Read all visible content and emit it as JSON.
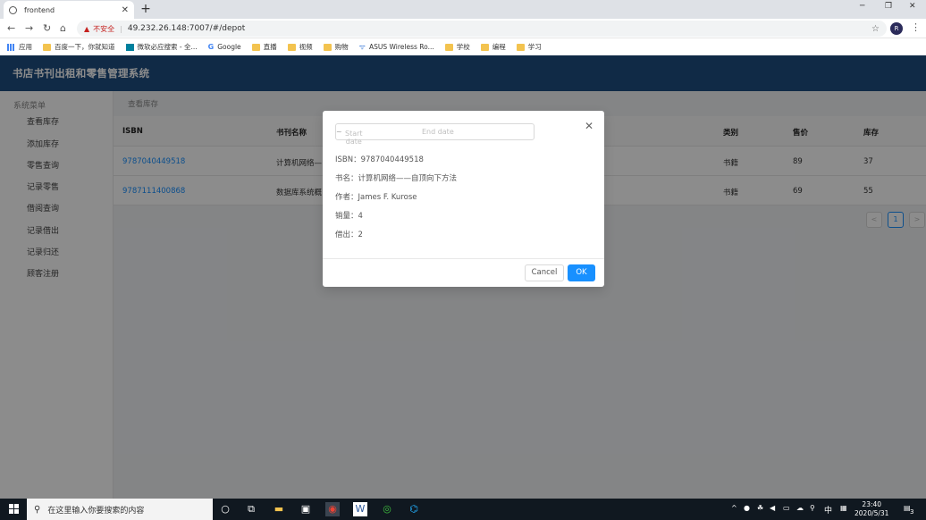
{
  "browser": {
    "tab_title": "frontend",
    "new_tab": "+",
    "insecure_label": "不安全",
    "url": "49.232.26.148:7007/#/depot",
    "bookmarks": [
      {
        "label": "应用",
        "icon": "apps-grid-icon"
      },
      {
        "label": "百度一下，你就知道",
        "icon": "folder-icon"
      },
      {
        "label": "微软必应搜索 - 全...",
        "icon": "bing-icon"
      },
      {
        "label": "Google",
        "icon": "google-icon"
      },
      {
        "label": "直播",
        "icon": "folder-icon"
      },
      {
        "label": "视频",
        "icon": "folder-icon"
      },
      {
        "label": "购物",
        "icon": "folder-icon"
      },
      {
        "label": "ASUS Wireless Ro...",
        "icon": "asus-icon"
      },
      {
        "label": "学校",
        "icon": "folder-icon"
      },
      {
        "label": "编程",
        "icon": "folder-icon"
      },
      {
        "label": "学习",
        "icon": "folder-icon"
      }
    ]
  },
  "app": {
    "title": "书店书刊出租和零售管理系统",
    "sidebar": {
      "group": "系统菜单",
      "items": [
        "查看库存",
        "添加库存",
        "零售查询",
        "记录零售",
        "借阅查询",
        "记录借出",
        "记录归还",
        "顾客注册"
      ]
    },
    "breadcrumb": "查看库存",
    "table": {
      "headers": {
        "isbn": "ISBN",
        "name": "书刊名称",
        "category": "类别",
        "price": "售价",
        "stock": "库存"
      },
      "rows": [
        {
          "isbn": "9787040449518",
          "name": "计算机网络—",
          "category": "书籍",
          "price": "89",
          "stock": "37"
        },
        {
          "isbn": "9787111400868",
          "name": "数据库系统概",
          "category": "书籍",
          "price": "69",
          "stock": "55"
        }
      ]
    },
    "pagination": {
      "prev": "<",
      "current": "1",
      "next": ">"
    }
  },
  "modal": {
    "start_placeholder": "Start date",
    "range_sep": "~",
    "end_placeholder": "End date",
    "isbn": "ISBN：9787040449518",
    "book_name": "书名：计算机网络——自顶向下方法",
    "author": "作者：James F. Kurose",
    "sales": "销量：4",
    "lent": "借出：2",
    "cancel_label": "Cancel",
    "ok_label": "OK"
  },
  "taskbar": {
    "search_placeholder": "在这里输入你要搜索的内容",
    "ime": "中",
    "time": "23:40",
    "date": "2020/5/31",
    "notifications": "3"
  },
  "colors": {
    "header": "#1e4d80",
    "primary": "#1890ff",
    "taskbar": "#101820"
  }
}
